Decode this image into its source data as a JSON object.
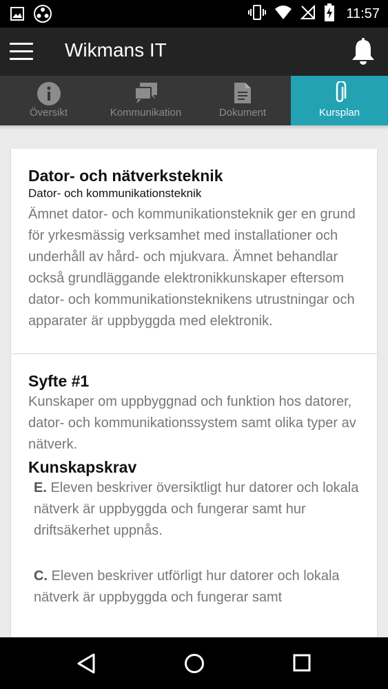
{
  "status_bar": {
    "time": "11:57",
    "icons": [
      "image-icon",
      "film-reel-icon",
      "vibrate-icon",
      "wifi-icon",
      "no-sim-icon",
      "battery-charging-icon"
    ]
  },
  "app_bar": {
    "title": "Wikmans IT",
    "menu_icon": "hamburger-menu-icon",
    "notification_icon": "bell-icon"
  },
  "tabs": [
    {
      "label": "Översikt",
      "icon": "info-icon",
      "active": false
    },
    {
      "label": "Kommunikation",
      "icon": "chat-icon",
      "active": false
    },
    {
      "label": "Dokument",
      "icon": "document-icon",
      "active": false
    },
    {
      "label": "Kursplan",
      "icon": "paperclip-icon",
      "active": true
    }
  ],
  "colors": {
    "accent": "#22a2b2",
    "app_bar": "#232323",
    "tab_bar": "#373737",
    "background": "#ebebeb"
  },
  "course": {
    "title": "Dator- och nätverksteknik",
    "subtitle": "Dator- och kommunikationsteknik",
    "description": "Ämnet dator- och kommunikationsteknik ger en grund för yrkesmässig verksamhet med installationer och underhåll av hård- och mjukvara. Ämnet behandlar också grundläggande elektronikkunskaper eftersom dator- och kommunikationsteknikens utrustningar och apparater är uppbyggda med elektronik."
  },
  "syfte": {
    "heading": "Syfte #1",
    "text": "Kunskaper om uppbyggnad och funktion hos datorer, dator- och kommunikationssystem samt olika typer av nätverk.",
    "krav_heading": "Kunskapskrav",
    "krav": [
      {
        "grade": "E.",
        "text": "Eleven beskriver översiktligt hur datorer och lokala nätverk är uppbyggda och fungerar samt hur driftsäkerhet uppnås."
      },
      {
        "grade": "C.",
        "text": "Eleven beskriver utförligt hur datorer och lokala nätverk är uppbyggda och fungerar samt"
      }
    ]
  },
  "nav_bar": {
    "buttons": [
      "back-icon",
      "home-icon",
      "recents-icon"
    ]
  }
}
